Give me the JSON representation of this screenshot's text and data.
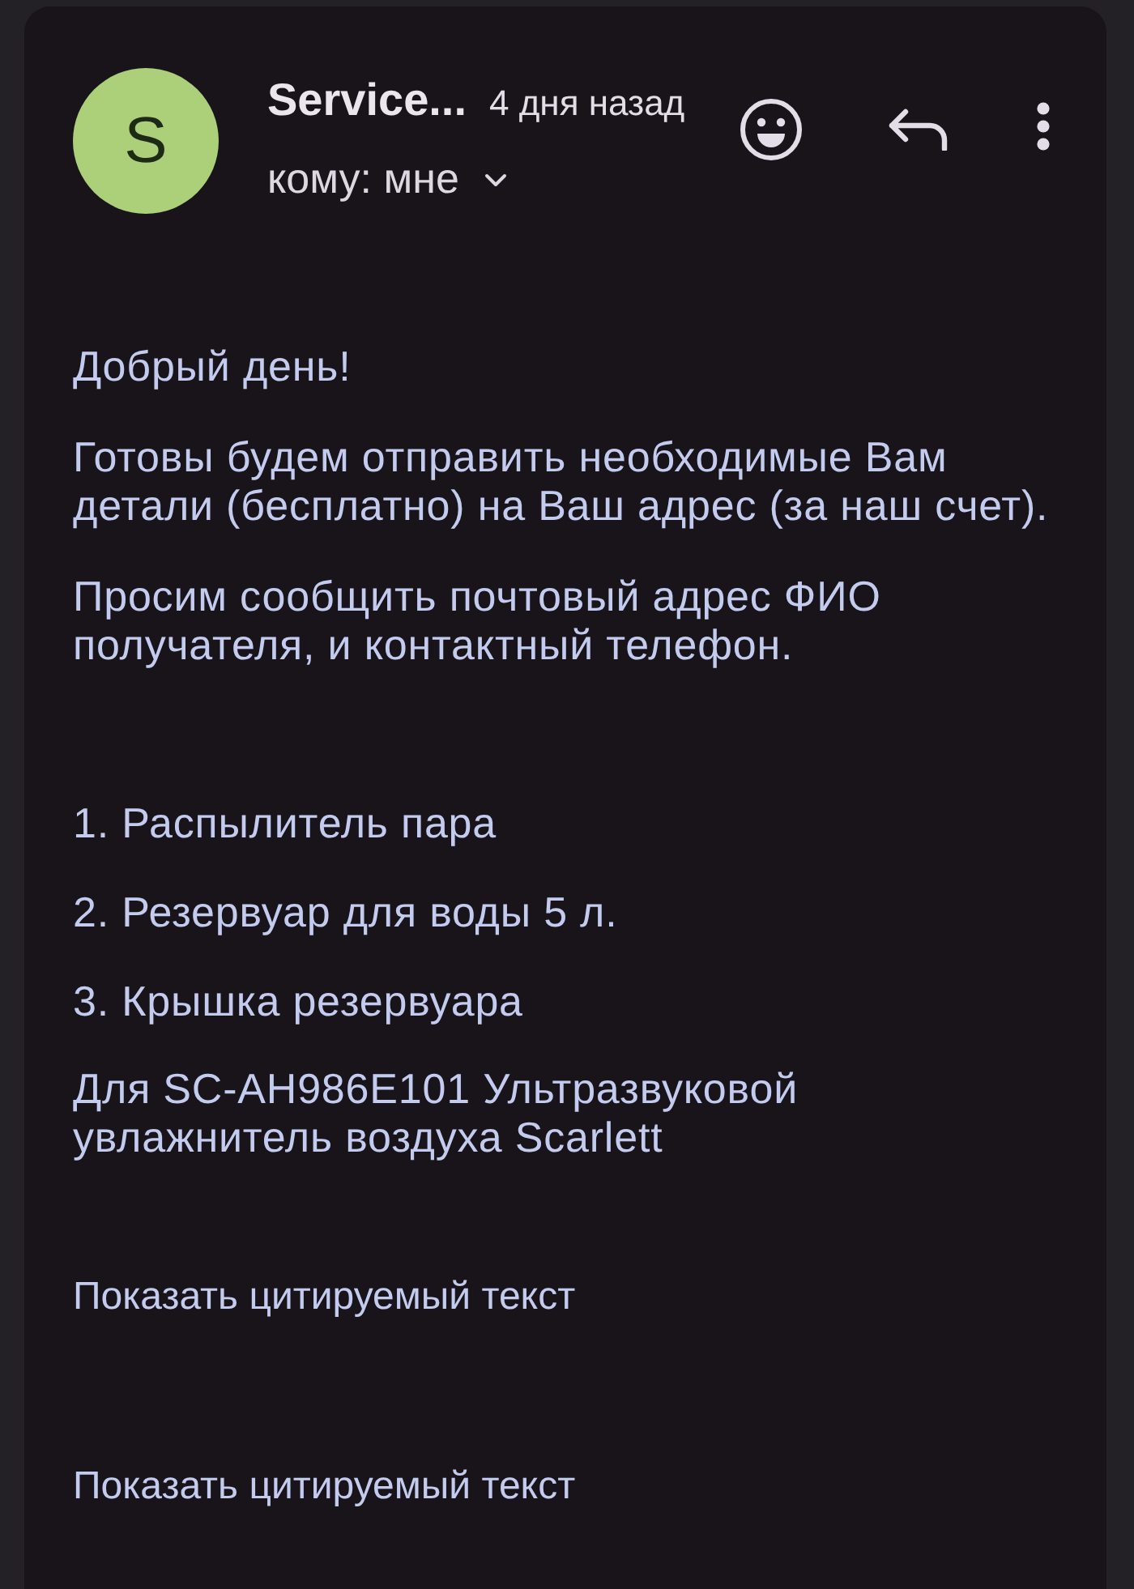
{
  "header": {
    "avatar_initial": "S",
    "sender": "Service...",
    "time": "4 дня назад",
    "recipient": "кому: мне",
    "recipient_expanded": false
  },
  "body": {
    "intro": [
      "Добрый день!",
      "Готовы будем отправить необходимые Вам\nдетали (бесплатно) на Ваш адрес (за наш счет).",
      "Просим сообщить почтовый адрес ФИО\nполучателя, и контактный телефон."
    ],
    "parts": [
      "1. Распылитель пара",
      "2. Резервуар для воды 5 л.",
      "3. Крышка резервуара"
    ],
    "product_note": "Для SC-AH986E101 Ультразвуковой\nувлажнитель воздуха Scarlett"
  },
  "quoted_text_links": [
    "Показать цитируемый текст",
    "Показать цитируемый текст"
  ]
}
